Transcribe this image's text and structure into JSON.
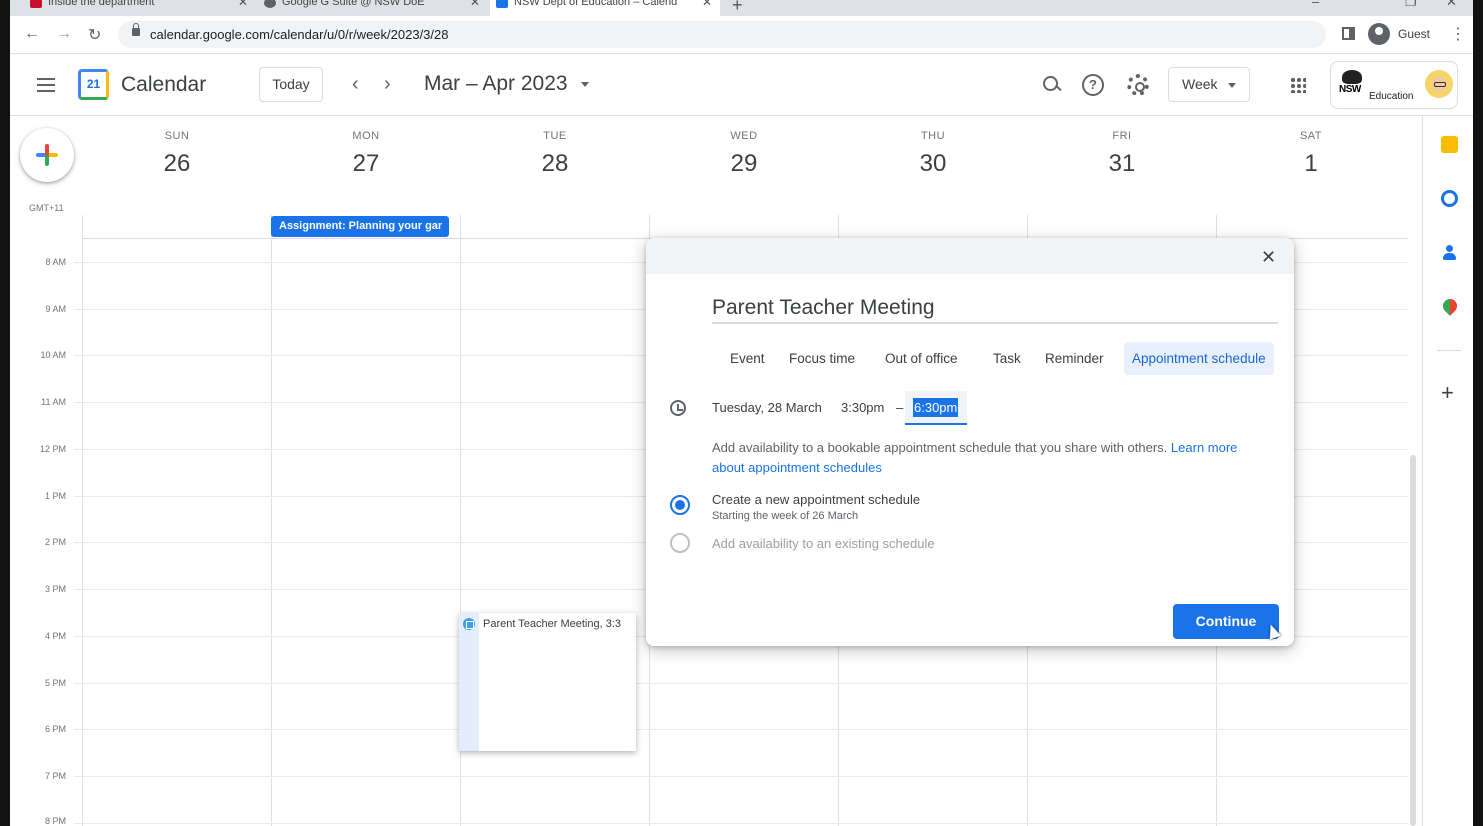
{
  "browser": {
    "tabs": [
      {
        "label": "Inside the department",
        "favicon_color": "#c8102e"
      },
      {
        "label": "Google G Suite @ NSW DoE",
        "favicon_color": "#5f6368"
      },
      {
        "label": "NSW Dept of Education – Calend",
        "favicon_color": "#1a73e8"
      }
    ],
    "new_tab_glyph": "+",
    "url": "calendar.google.com/calendar/u/0/r/week/2023/3/28",
    "profile_label": "Guest"
  },
  "header": {
    "logo_day": "21",
    "app_name": "Calendar",
    "today_label": "Today",
    "prev_glyph": "‹",
    "next_glyph": "›",
    "range_title": "Mar – Apr 2023",
    "help_glyph": "?",
    "view_label": "Week",
    "org_logo_text": "NSW",
    "org_label": "Education"
  },
  "week": {
    "timezone": "GMT+11",
    "days": [
      {
        "dow": "SUN",
        "date": "26"
      },
      {
        "dow": "MON",
        "date": "27"
      },
      {
        "dow": "TUE",
        "date": "28"
      },
      {
        "dow": "WED",
        "date": "29"
      },
      {
        "dow": "THU",
        "date": "30"
      },
      {
        "dow": "FRI",
        "date": "31"
      },
      {
        "dow": "SAT",
        "date": "1"
      }
    ],
    "hours": [
      "8 AM",
      "9 AM",
      "10 AM",
      "11 AM",
      "12 PM",
      "1 PM",
      "2 PM",
      "3 PM",
      "4 PM",
      "5 PM",
      "6 PM",
      "7 PM",
      "8 PM"
    ],
    "allday_event": "Assignment: Planning your gar",
    "draft_event": "Parent Teacher Meeting, 3:3"
  },
  "side_panel": {
    "icons": [
      "keep-icon",
      "tasks-icon",
      "contacts-icon",
      "maps-icon"
    ],
    "add_glyph": "+"
  },
  "dialog": {
    "close_glyph": "✕",
    "title": "Parent Teacher Meeting",
    "tabs": [
      "Event",
      "Focus time",
      "Out of office",
      "Task",
      "Reminder",
      "Appointment schedule"
    ],
    "active_tab": "Appointment schedule",
    "date": "Tuesday, 28 March",
    "start_time": "3:30pm",
    "dash": "–",
    "end_time": "6:30pm",
    "description": "Add availability to a bookable appointment schedule that you share with others.",
    "learn_more_link": "Learn more about appointment schedules",
    "option_new": "Create a new appointment schedule",
    "option_new_sub": "Starting the week of 26 March",
    "option_existing": "Add availability to an existing schedule",
    "continue_label": "Continue"
  },
  "colors": {
    "accent": "#1a73e8",
    "active_tab_bg": "#e8f0fe"
  }
}
